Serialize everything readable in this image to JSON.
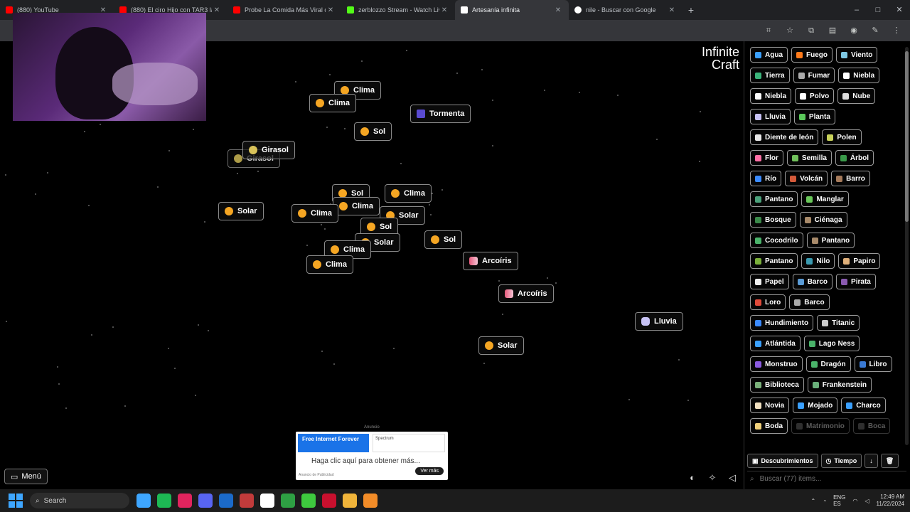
{
  "browser": {
    "tabs": [
      {
        "title": "(880) YouTube",
        "color": "#ff0000",
        "active": false
      },
      {
        "title": "(880) El ciro Hijo con TAR3 la...",
        "color": "#ff0000",
        "active": false
      },
      {
        "title": "Probe La Comida Más Viral de...",
        "color": "#ff0000",
        "active": false
      },
      {
        "title": "zerblozzo Stream - Watch Live...",
        "color": "#53fc18",
        "active": false
      },
      {
        "title": "Artesanía infinita",
        "color": "#ffffff",
        "active": true
      },
      {
        "title": "nile - Buscar con Google",
        "color": "#ffffff",
        "active": false
      }
    ],
    "new_tab": "+",
    "win_min": "–",
    "win_max": "□",
    "win_close": "✕"
  },
  "logo": {
    "line1": "Infinite",
    "line2": "Craft"
  },
  "canvas_items": [
    {
      "label": "Clima",
      "icon": "sun"
    },
    {
      "label": "Clima",
      "icon": "sun"
    },
    {
      "label": "Tormenta",
      "icon": "storm"
    },
    {
      "label": "Sol",
      "icon": "sun"
    },
    {
      "label": "Girasol",
      "icon": "flower"
    },
    {
      "label": "Girasol",
      "icon": "flower"
    },
    {
      "label": "Sol",
      "icon": "sun"
    },
    {
      "label": "Clima",
      "icon": "sun"
    },
    {
      "label": "Solar",
      "icon": "sun"
    },
    {
      "label": "Clima",
      "icon": "sun"
    },
    {
      "label": "Clima",
      "icon": "sun"
    },
    {
      "label": "Solar",
      "icon": "sun"
    },
    {
      "label": "Sol",
      "icon": "sun"
    },
    {
      "label": "Sol",
      "icon": "sun"
    },
    {
      "label": "Solar",
      "icon": "sun"
    },
    {
      "label": "Clima",
      "icon": "sun"
    },
    {
      "label": "Clima",
      "icon": "sun"
    },
    {
      "label": "Arcoíris",
      "icon": "rainbow"
    },
    {
      "label": "Arcoíris",
      "icon": "rainbow"
    },
    {
      "label": "Lluvia",
      "icon": "cloud"
    },
    {
      "label": "Solar",
      "icon": "sun"
    }
  ],
  "menu_label": "Menú",
  "ad": {
    "label": "Anuncio",
    "headline": "Free Internet Forever",
    "side": "Spectrum",
    "cta_text": "Haga clic aquí para obtener más...",
    "button": "Ver más",
    "footer": "Anuncio de Publicidad"
  },
  "sidebar": {
    "items": [
      {
        "label": "Agua",
        "color": "#3aa0ff"
      },
      {
        "label": "Fuego",
        "color": "#ff7a1a"
      },
      {
        "label": "Viento",
        "color": "#7ec8e3"
      },
      {
        "label": "Tierra",
        "color": "#3ab37a"
      },
      {
        "label": "Fumar",
        "color": "#aaaaaa"
      },
      {
        "label": "Niebla",
        "color": "#ffffff"
      },
      {
        "label": "Niebla",
        "color": "#ffffff"
      },
      {
        "label": "Polvo",
        "color": "#ffffff"
      },
      {
        "label": "Nube",
        "color": "#dddddd"
      },
      {
        "label": "Lluvia",
        "color": "#c7c2f5"
      },
      {
        "label": "Planta",
        "color": "#5ac85a"
      },
      {
        "label": "Diente de león",
        "color": "#e8e8e8"
      },
      {
        "label": "Polen",
        "color": "#c8d25a"
      },
      {
        "label": "Flor",
        "color": "#ff6fa5"
      },
      {
        "label": "Semilla",
        "color": "#6fbf5a"
      },
      {
        "label": "Árbol",
        "color": "#3a9a4a"
      },
      {
        "label": "Río",
        "color": "#3a8aff"
      },
      {
        "label": "Volcán",
        "color": "#d45a3a"
      },
      {
        "label": "Barro",
        "color": "#a57a5a"
      },
      {
        "label": "Pantano",
        "color": "#4aa07a"
      },
      {
        "label": "Manglar",
        "color": "#6ac85a"
      },
      {
        "label": "Bosque",
        "color": "#3a8a4a"
      },
      {
        "label": "Ciénaga",
        "color": "#a88a6a"
      },
      {
        "label": "Cocodrilo",
        "color": "#4ab36a"
      },
      {
        "label": "Pantano",
        "color": "#a88a6a"
      },
      {
        "label": "Pantano",
        "color": "#7ab03a"
      },
      {
        "label": "Nilo",
        "color": "#3a9ab0"
      },
      {
        "label": "Papiro",
        "color": "#e0b07a"
      },
      {
        "label": "Papel",
        "color": "#f0f0f0"
      },
      {
        "label": "Barco",
        "color": "#5a9ad4"
      },
      {
        "label": "Pirata",
        "color": "#8a5ab0"
      },
      {
        "label": "Loro",
        "color": "#e04a3a"
      },
      {
        "label": "Barco",
        "color": "#aaaaaa"
      },
      {
        "label": "Hundimiento",
        "color": "#3a8aff"
      },
      {
        "label": "Titanic",
        "color": "#cccccc"
      },
      {
        "label": "Atlántida",
        "color": "#3aa0ff"
      },
      {
        "label": "Lago Ness",
        "color": "#4ab36a"
      },
      {
        "label": "Monstruo",
        "color": "#8a5ae0"
      },
      {
        "label": "Dragón",
        "color": "#4ab36a"
      },
      {
        "label": "Libro",
        "color": "#3a7ad4"
      },
      {
        "label": "Biblioteca",
        "color": "#7ab07a"
      },
      {
        "label": "Frankenstein",
        "color": "#6ab07a"
      },
      {
        "label": "Novia",
        "color": "#f0e0c0"
      },
      {
        "label": "Mojado",
        "color": "#3aa0ff"
      },
      {
        "label": "Charco",
        "color": "#3aa0ff"
      },
      {
        "label": "Boda",
        "color": "#f0d07a"
      },
      {
        "label": "Matrimonio",
        "color": "#888888"
      },
      {
        "label": "Boca",
        "color": "#888888"
      }
    ],
    "tab_discoveries": "Descubrimientos",
    "tab_time": "Tiempo",
    "sort_icon": "↓",
    "delete_icon": "🗑",
    "search_placeholder": "Buscar (77) items..."
  },
  "taskbar": {
    "search": "Search",
    "apps": [
      "#3ea6ff",
      "#1db954",
      "#e0245e",
      "#5865f2",
      "#1b6ac9",
      "#c13b3b",
      "#ffffff",
      "#2ea043",
      "#3ec93e",
      "#c8102e",
      "#f0b43a",
      "#f28c28"
    ],
    "lang": "ENG\nES",
    "time": "12:49 AM",
    "date": "11/22/2024"
  }
}
